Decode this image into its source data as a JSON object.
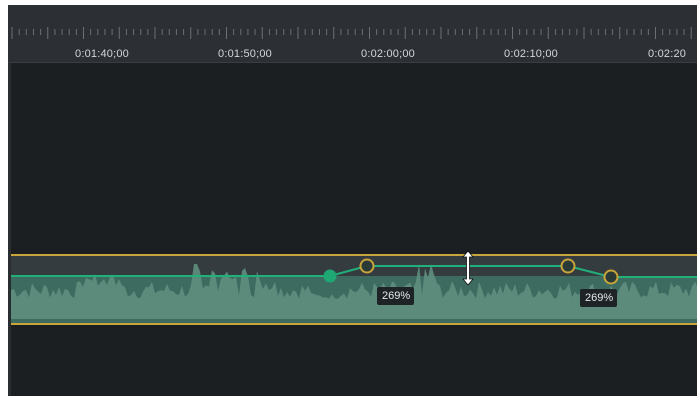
{
  "timeline": {
    "ruler_labels": [
      "0:01:40;00",
      "0:01:50;00",
      "0:02:00;00",
      "0:02:10;00",
      "0:02:20"
    ]
  },
  "audio_clip": {
    "volume_points_left": "269%",
    "volume_points_right": "269%"
  },
  "icons": {
    "cursor": "vertical-resize-icon"
  },
  "colors": {
    "background": "#1b1f22",
    "ruler": "#2c3034",
    "clip_border": "#c9a43a",
    "volume_line": "#22b07a",
    "waveform": "#5e8a7c",
    "keyframe": "#c9a43a"
  }
}
